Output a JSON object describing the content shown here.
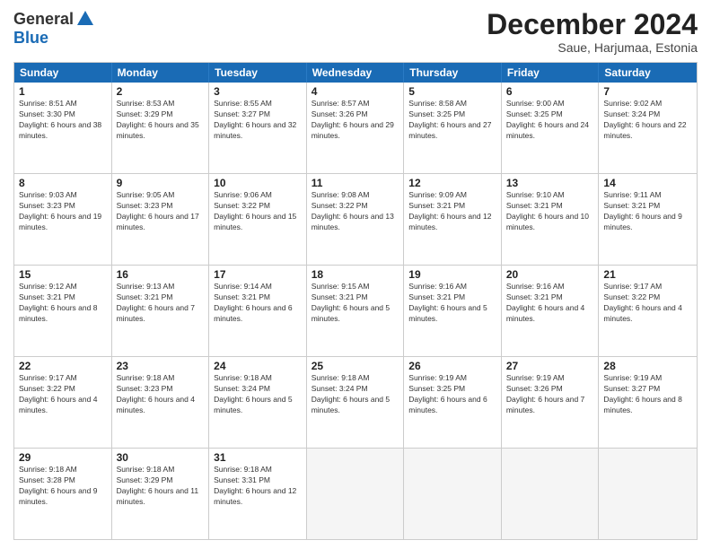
{
  "header": {
    "logo": {
      "general": "General",
      "blue": "Blue"
    },
    "title": "December 2024",
    "location": "Saue, Harjumaa, Estonia"
  },
  "weekdays": [
    "Sunday",
    "Monday",
    "Tuesday",
    "Wednesday",
    "Thursday",
    "Friday",
    "Saturday"
  ],
  "rows": [
    [
      {
        "day": "1",
        "sunrise": "Sunrise: 8:51 AM",
        "sunset": "Sunset: 3:30 PM",
        "daylight": "Daylight: 6 hours and 38 minutes."
      },
      {
        "day": "2",
        "sunrise": "Sunrise: 8:53 AM",
        "sunset": "Sunset: 3:29 PM",
        "daylight": "Daylight: 6 hours and 35 minutes."
      },
      {
        "day": "3",
        "sunrise": "Sunrise: 8:55 AM",
        "sunset": "Sunset: 3:27 PM",
        "daylight": "Daylight: 6 hours and 32 minutes."
      },
      {
        "day": "4",
        "sunrise": "Sunrise: 8:57 AM",
        "sunset": "Sunset: 3:26 PM",
        "daylight": "Daylight: 6 hours and 29 minutes."
      },
      {
        "day": "5",
        "sunrise": "Sunrise: 8:58 AM",
        "sunset": "Sunset: 3:25 PM",
        "daylight": "Daylight: 6 hours and 27 minutes."
      },
      {
        "day": "6",
        "sunrise": "Sunrise: 9:00 AM",
        "sunset": "Sunset: 3:25 PM",
        "daylight": "Daylight: 6 hours and 24 minutes."
      },
      {
        "day": "7",
        "sunrise": "Sunrise: 9:02 AM",
        "sunset": "Sunset: 3:24 PM",
        "daylight": "Daylight: 6 hours and 22 minutes."
      }
    ],
    [
      {
        "day": "8",
        "sunrise": "Sunrise: 9:03 AM",
        "sunset": "Sunset: 3:23 PM",
        "daylight": "Daylight: 6 hours and 19 minutes."
      },
      {
        "day": "9",
        "sunrise": "Sunrise: 9:05 AM",
        "sunset": "Sunset: 3:23 PM",
        "daylight": "Daylight: 6 hours and 17 minutes."
      },
      {
        "day": "10",
        "sunrise": "Sunrise: 9:06 AM",
        "sunset": "Sunset: 3:22 PM",
        "daylight": "Daylight: 6 hours and 15 minutes."
      },
      {
        "day": "11",
        "sunrise": "Sunrise: 9:08 AM",
        "sunset": "Sunset: 3:22 PM",
        "daylight": "Daylight: 6 hours and 13 minutes."
      },
      {
        "day": "12",
        "sunrise": "Sunrise: 9:09 AM",
        "sunset": "Sunset: 3:21 PM",
        "daylight": "Daylight: 6 hours and 12 minutes."
      },
      {
        "day": "13",
        "sunrise": "Sunrise: 9:10 AM",
        "sunset": "Sunset: 3:21 PM",
        "daylight": "Daylight: 6 hours and 10 minutes."
      },
      {
        "day": "14",
        "sunrise": "Sunrise: 9:11 AM",
        "sunset": "Sunset: 3:21 PM",
        "daylight": "Daylight: 6 hours and 9 minutes."
      }
    ],
    [
      {
        "day": "15",
        "sunrise": "Sunrise: 9:12 AM",
        "sunset": "Sunset: 3:21 PM",
        "daylight": "Daylight: 6 hours and 8 minutes."
      },
      {
        "day": "16",
        "sunrise": "Sunrise: 9:13 AM",
        "sunset": "Sunset: 3:21 PM",
        "daylight": "Daylight: 6 hours and 7 minutes."
      },
      {
        "day": "17",
        "sunrise": "Sunrise: 9:14 AM",
        "sunset": "Sunset: 3:21 PM",
        "daylight": "Daylight: 6 hours and 6 minutes."
      },
      {
        "day": "18",
        "sunrise": "Sunrise: 9:15 AM",
        "sunset": "Sunset: 3:21 PM",
        "daylight": "Daylight: 6 hours and 5 minutes."
      },
      {
        "day": "19",
        "sunrise": "Sunrise: 9:16 AM",
        "sunset": "Sunset: 3:21 PM",
        "daylight": "Daylight: 6 hours and 5 minutes."
      },
      {
        "day": "20",
        "sunrise": "Sunrise: 9:16 AM",
        "sunset": "Sunset: 3:21 PM",
        "daylight": "Daylight: 6 hours and 4 minutes."
      },
      {
        "day": "21",
        "sunrise": "Sunrise: 9:17 AM",
        "sunset": "Sunset: 3:22 PM",
        "daylight": "Daylight: 6 hours and 4 minutes."
      }
    ],
    [
      {
        "day": "22",
        "sunrise": "Sunrise: 9:17 AM",
        "sunset": "Sunset: 3:22 PM",
        "daylight": "Daylight: 6 hours and 4 minutes."
      },
      {
        "day": "23",
        "sunrise": "Sunrise: 9:18 AM",
        "sunset": "Sunset: 3:23 PM",
        "daylight": "Daylight: 6 hours and 4 minutes."
      },
      {
        "day": "24",
        "sunrise": "Sunrise: 9:18 AM",
        "sunset": "Sunset: 3:24 PM",
        "daylight": "Daylight: 6 hours and 5 minutes."
      },
      {
        "day": "25",
        "sunrise": "Sunrise: 9:18 AM",
        "sunset": "Sunset: 3:24 PM",
        "daylight": "Daylight: 6 hours and 5 minutes."
      },
      {
        "day": "26",
        "sunrise": "Sunrise: 9:19 AM",
        "sunset": "Sunset: 3:25 PM",
        "daylight": "Daylight: 6 hours and 6 minutes."
      },
      {
        "day": "27",
        "sunrise": "Sunrise: 9:19 AM",
        "sunset": "Sunset: 3:26 PM",
        "daylight": "Daylight: 6 hours and 7 minutes."
      },
      {
        "day": "28",
        "sunrise": "Sunrise: 9:19 AM",
        "sunset": "Sunset: 3:27 PM",
        "daylight": "Daylight: 6 hours and 8 minutes."
      }
    ],
    [
      {
        "day": "29",
        "sunrise": "Sunrise: 9:18 AM",
        "sunset": "Sunset: 3:28 PM",
        "daylight": "Daylight: 6 hours and 9 minutes."
      },
      {
        "day": "30",
        "sunrise": "Sunrise: 9:18 AM",
        "sunset": "Sunset: 3:29 PM",
        "daylight": "Daylight: 6 hours and 11 minutes."
      },
      {
        "day": "31",
        "sunrise": "Sunrise: 9:18 AM",
        "sunset": "Sunset: 3:31 PM",
        "daylight": "Daylight: 6 hours and 12 minutes."
      },
      {
        "day": "",
        "sunrise": "",
        "sunset": "",
        "daylight": ""
      },
      {
        "day": "",
        "sunrise": "",
        "sunset": "",
        "daylight": ""
      },
      {
        "day": "",
        "sunrise": "",
        "sunset": "",
        "daylight": ""
      },
      {
        "day": "",
        "sunrise": "",
        "sunset": "",
        "daylight": ""
      }
    ]
  ]
}
